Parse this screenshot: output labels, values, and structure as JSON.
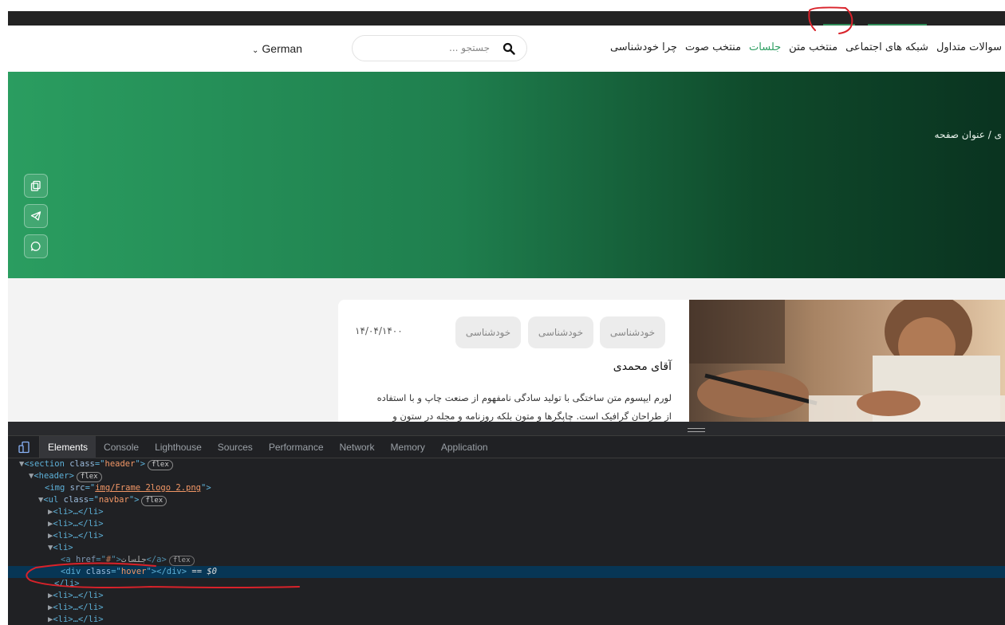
{
  "nav": {
    "language": "German",
    "search_placeholder": "جستجو ...",
    "menu": [
      "چرا خودشناسی",
      "منتخب صوت",
      "جلسات",
      "منتخب متن",
      "شبکه های اجتماعی",
      "سوالات متداول"
    ]
  },
  "hero": {
    "breadcrumb": "ی / عنوان صفحه"
  },
  "card": {
    "tags": [
      "خودشناسی",
      "خودشناسی",
      "خودشناسی"
    ],
    "date": "۱۴/۰۴/۱۴۰۰",
    "name": "آقای محمدی",
    "desc_line1": "لورم ایپسوم متن ساختگی با تولید سادگی نامفهوم از صنعت چاپ و با استفاده",
    "desc_line2": "از طراحان گرافیک است. چاپگرها و متون بلکه روزنامه و مجله در ستون و"
  },
  "devtools": {
    "tabs": [
      "Elements",
      "Console",
      "Lighthouse",
      "Sources",
      "Performance",
      "Network",
      "Memory",
      "Application"
    ],
    "active_tab": "Elements",
    "flex_badge": "flex",
    "img_src": "img/Frame 2logo 2.png",
    "section_class": "header",
    "ul_class": "navbar",
    "div_class": "hover",
    "a_href": "#",
    "a_text": "جلسات",
    "selected_suffix": "== $0",
    "li_collapsed": "<li>…</li>"
  },
  "colors": {
    "accent": "#2e9e62",
    "hero_start": "#2a9d60",
    "hero_end": "#0a3320",
    "annotation": "#d9222a",
    "devtools_bg": "#202124"
  }
}
